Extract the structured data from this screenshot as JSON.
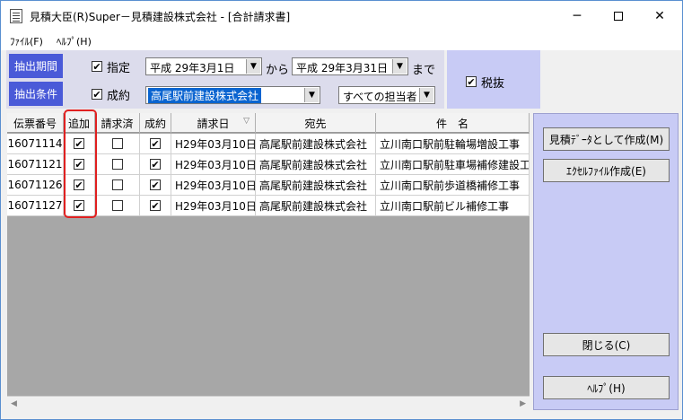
{
  "window": {
    "title": "見積大臣(R)Super－見積建設株式会社 - [合計請求書]",
    "minimize": "─",
    "close": "✕"
  },
  "menu": {
    "file": "ﾌｧｲﾙ(F)",
    "help": "ﾍﾙﾌﾟ(H)"
  },
  "filter": {
    "period_label": "抽出期間",
    "designated_label": "指定",
    "designated_checked": true,
    "date_from": "平成 29年3月1日",
    "from_text": "から",
    "date_to": "平成 29年3月31日",
    "to_text": "まで",
    "condition_label": "抽出条件",
    "contracted_label": "成約",
    "contracted_checked": true,
    "client": "高尾駅前建設株式会社",
    "staff": "すべての担当者",
    "tax_label": "税抜",
    "tax_checked": true
  },
  "grid": {
    "columns": [
      "伝票番号",
      "追加",
      "請求済",
      "成約",
      "請求日",
      "宛先",
      "件　名"
    ],
    "sort_icon": "▽",
    "rows": [
      {
        "slip": "16071114",
        "add": true,
        "billed": false,
        "contract": true,
        "date": "H29年03月10日",
        "to": "高尾駅前建設株式会社",
        "subject": "立川南口駅前駐輪場増設工事"
      },
      {
        "slip": "16071121",
        "add": true,
        "billed": false,
        "contract": true,
        "date": "H29年03月10日",
        "to": "高尾駅前建設株式会社",
        "subject": "立川南口駅前駐車場補修建設工事"
      },
      {
        "slip": "16071126",
        "add": true,
        "billed": false,
        "contract": true,
        "date": "H29年03月10日",
        "to": "高尾駅前建設株式会社",
        "subject": "立川南口駅前歩道橋補修工事"
      },
      {
        "slip": "16071127",
        "add": true,
        "billed": false,
        "contract": true,
        "date": "H29年03月10日",
        "to": "高尾駅前建設株式会社",
        "subject": "立川南口駅前ビル補修工事"
      }
    ]
  },
  "side": {
    "create_estimate": "見積ﾃﾞｰﾀとして作成(M)",
    "create_excel": "ｴｸｾﾙﾌｧｲﾙ作成(E)",
    "close": "閉じる(C)",
    "help": "ﾍﾙﾌﾟ(H)"
  },
  "colors": {
    "label_bg": "#4a5ad8",
    "panel_bg": "#c8cbf5",
    "grid_bg": "#a7a7a7",
    "highlight": "#e02020"
  }
}
